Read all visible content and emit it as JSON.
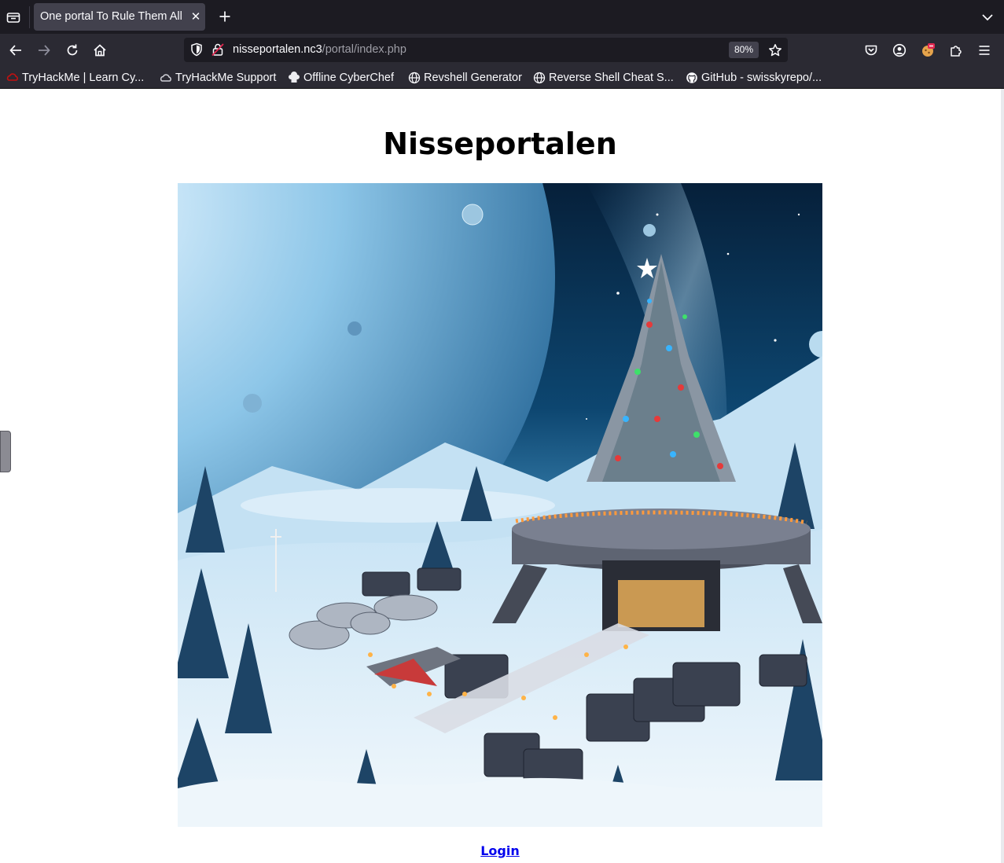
{
  "browser": {
    "tab": {
      "title": "One portal To Rule Them All"
    },
    "url": {
      "host": "nisseportalen.nc3",
      "path": "/portal/index.php"
    },
    "zoom": "80%",
    "bookmarks": [
      {
        "label": "TryHackMe | Learn Cy...",
        "icon": "tryhackme-icon"
      },
      {
        "label": "TryHackMe Support",
        "icon": "cloud-icon"
      },
      {
        "label": "Offline CyberChef",
        "icon": "chef-hat-icon"
      },
      {
        "label": "Revshell Generator",
        "icon": "globe-icon"
      },
      {
        "label": "Reverse Shell Cheat S...",
        "icon": "globe-icon"
      },
      {
        "label": "GitHub - swisskyrepo/...",
        "icon": "github-icon"
      }
    ]
  },
  "page": {
    "heading": "Nisseportalen",
    "login_label": "Login"
  },
  "colors": {
    "chrome_dark": "#1c1b22",
    "chrome_mid": "#2b2a33",
    "tab_active": "#42414d",
    "link": "#0000ee"
  }
}
